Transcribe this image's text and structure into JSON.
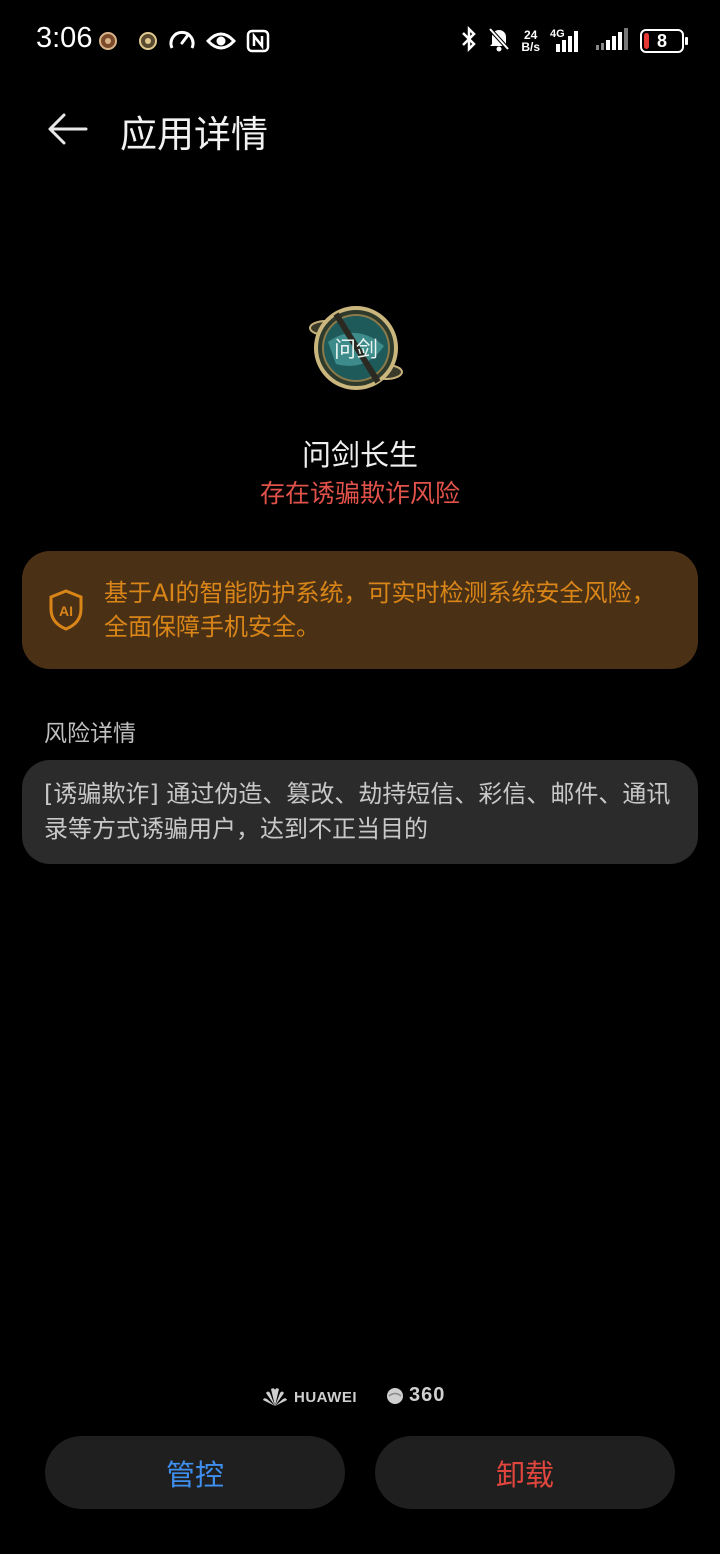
{
  "status_bar": {
    "time": "3:06",
    "net_speed_value": "24",
    "net_speed_unit": "B/s",
    "network_type": "4G",
    "battery_level": "8",
    "battery_fraction": 0.08,
    "icons": [
      "app-notification-icon",
      "app-notification-icon",
      "speedometer-icon",
      "eye-icon",
      "nfc-icon",
      "bluetooth-icon",
      "bell-muted-icon",
      "signal-icon",
      "signal-icon",
      "battery-icon"
    ]
  },
  "header": {
    "title": "应用详情"
  },
  "app": {
    "name": "问剑长生",
    "risk_label": "存在诱骗欺诈风险"
  },
  "ai_notice": {
    "badge": "AI",
    "text": "基于AI的智能防护系统，可实时检测系统安全风险，全面保障手机安全。"
  },
  "risk_section": {
    "label": "风险详情",
    "detail": "[诱骗欺诈] 通过伪造、篡改、劫持短信、彩信、邮件、通讯录等方式诱骗用户，达到不正当目的"
  },
  "partners": {
    "huawei": "HUAWEI",
    "three_sixty": "360"
  },
  "actions": {
    "control": "管控",
    "uninstall": "卸载"
  },
  "colors": {
    "risk_red": "#e0524a",
    "ai_card_bg": "#4a3116",
    "ai_text": "#d98518",
    "control_blue": "#3f8ff0",
    "uninstall_red": "#e0463e"
  }
}
